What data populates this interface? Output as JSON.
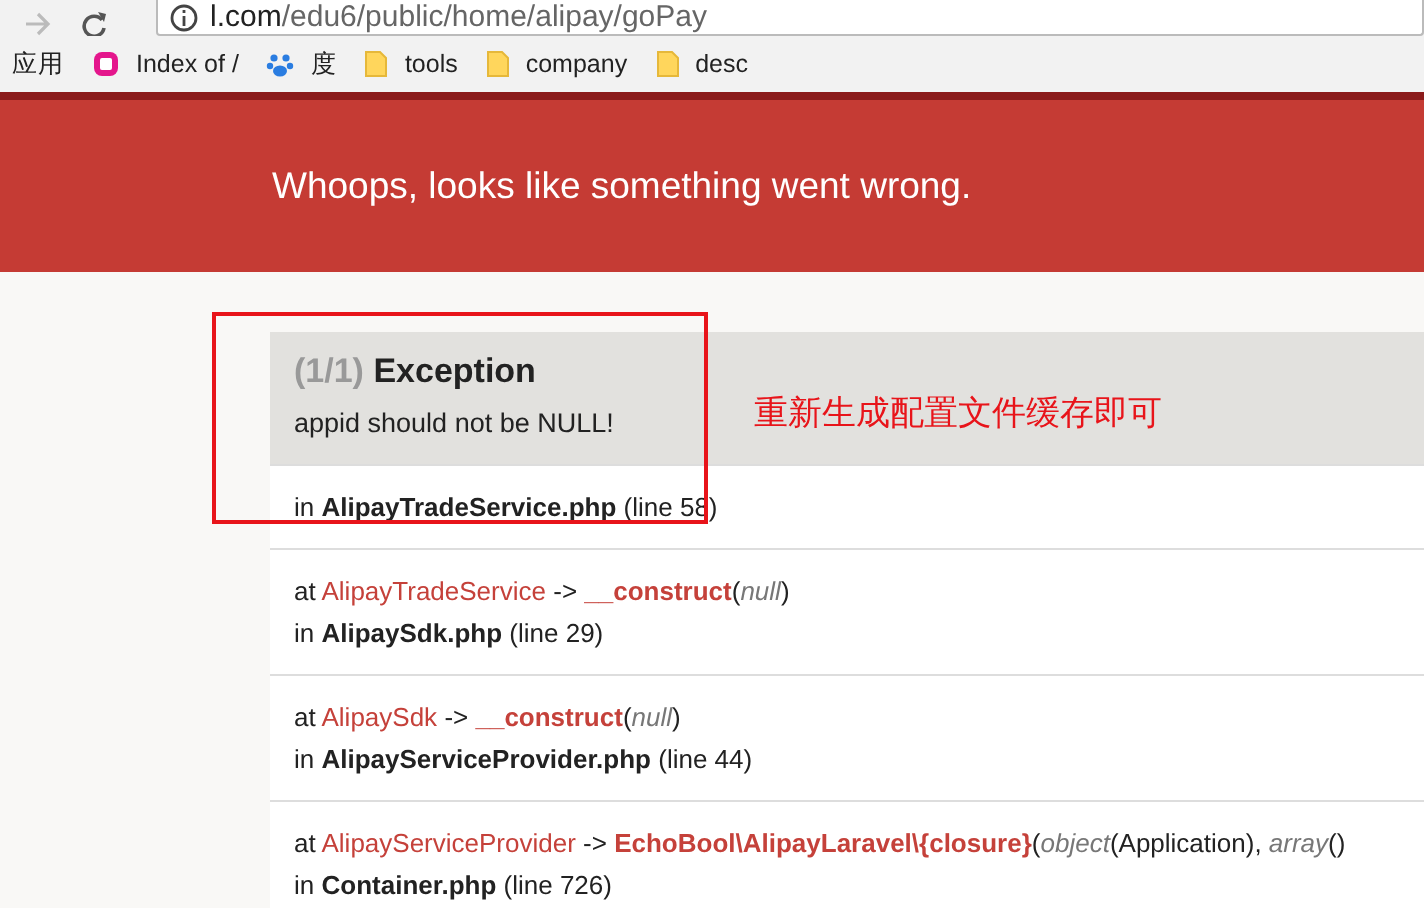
{
  "address_bar": {
    "host": "l.com",
    "path": "/edu6/public/home/alipay/goPay"
  },
  "bookmarks": [
    {
      "label": "应用",
      "kind": "apps"
    },
    {
      "label": "Index of /",
      "kind": "site"
    },
    {
      "label": "度",
      "kind": "paw"
    },
    {
      "label": "tools",
      "kind": "folder"
    },
    {
      "label": "company",
      "kind": "folder"
    },
    {
      "label": "desc",
      "kind": "folder"
    }
  ],
  "header": {
    "title": "Whoops, looks like something went wrong."
  },
  "exception": {
    "count": "(1/1)",
    "title": "Exception",
    "message": "appid should not be NULL!"
  },
  "annotation": {
    "text": "重新生成配置文件缓存即可"
  },
  "trace": [
    {
      "in": "in",
      "file": "AlipayTradeService.php",
      "line": "(line 58)"
    },
    {
      "at": "at",
      "class": "AlipayTradeService",
      "arrow": "->",
      "function": "__construct",
      "open": "(",
      "args": [
        {
          "kind": "type",
          "text": "null"
        }
      ],
      "close": ")",
      "in": "in",
      "file": "AlipaySdk.php",
      "line": "(line 29)"
    },
    {
      "at": "at",
      "class": "AlipaySdk",
      "arrow": "->",
      "function": "__construct",
      "open": "(",
      "args": [
        {
          "kind": "type",
          "text": "null"
        }
      ],
      "close": ")",
      "in": "in",
      "file": "AlipayServiceProvider.php",
      "line": "(line 44)"
    },
    {
      "at": "at",
      "class": "AlipayServiceProvider",
      "arrow": "->",
      "function": "EchoBool\\AlipayLaravel\\{closure}",
      "open": "(",
      "args": [
        {
          "kind": "type",
          "text": "object"
        },
        {
          "kind": "plain",
          "text": "(Application), "
        },
        {
          "kind": "type",
          "text": "array"
        },
        {
          "kind": "plain",
          "text": "()"
        }
      ],
      "in": "in",
      "file": "Container.php",
      "line": "(line 726)"
    }
  ]
}
